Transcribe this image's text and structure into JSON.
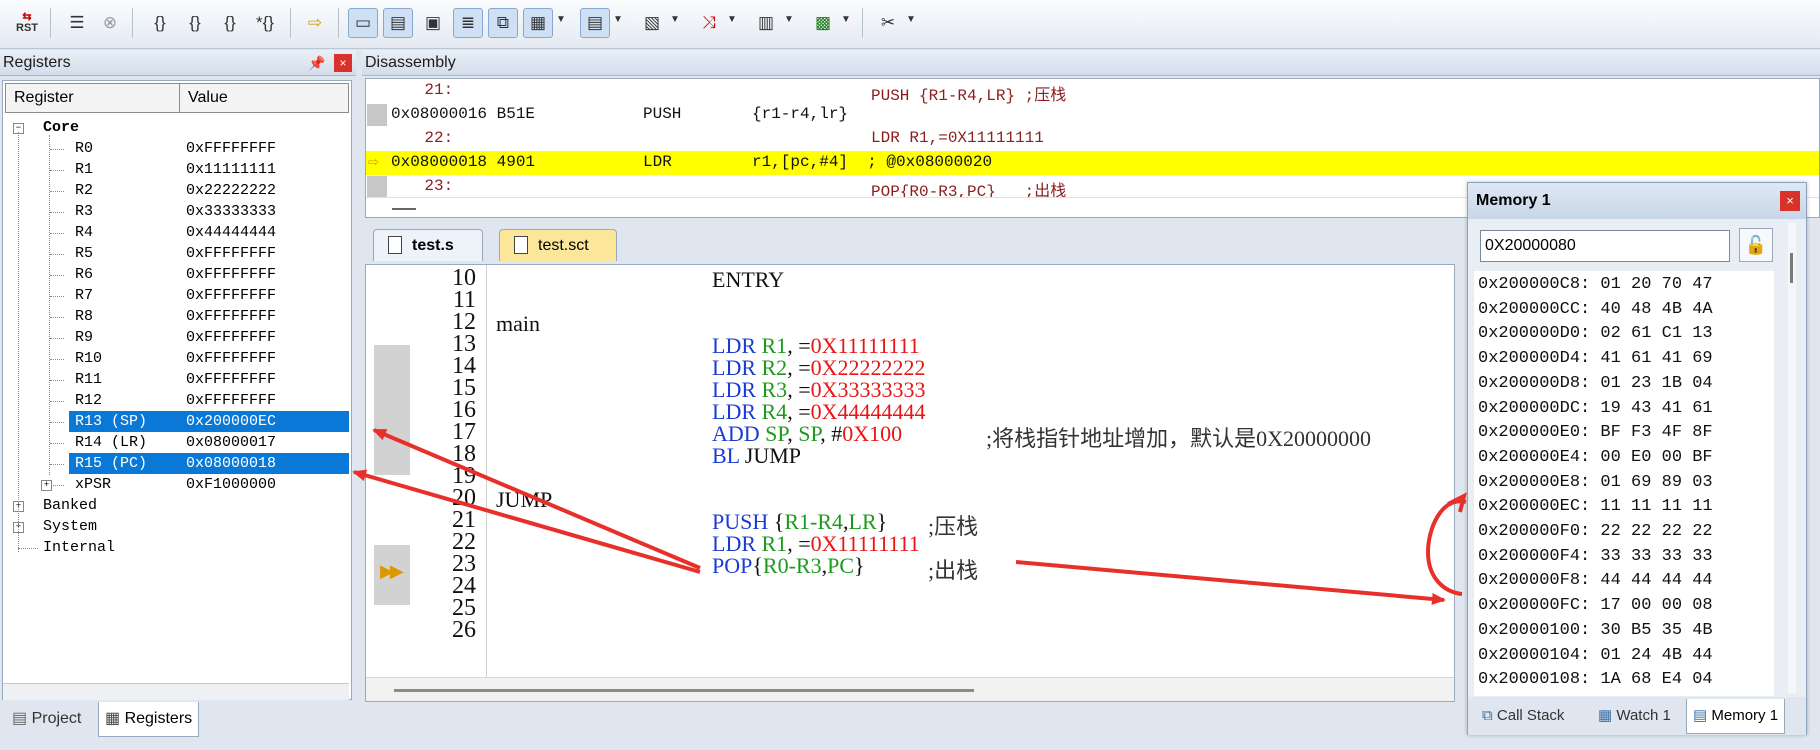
{
  "toolbar": {
    "rst_label": "RST"
  },
  "registers": {
    "title": "Registers",
    "col_register": "Register",
    "col_value": "Value",
    "core_label": "Core",
    "rows": [
      {
        "name": "R0",
        "value": "0xFFFFFFFF"
      },
      {
        "name": "R1",
        "value": "0x11111111"
      },
      {
        "name": "R2",
        "value": "0x22222222"
      },
      {
        "name": "R3",
        "value": "0x33333333"
      },
      {
        "name": "R4",
        "value": "0x44444444"
      },
      {
        "name": "R5",
        "value": "0xFFFFFFFF"
      },
      {
        "name": "R6",
        "value": "0xFFFFFFFF"
      },
      {
        "name": "R7",
        "value": "0xFFFFFFFF"
      },
      {
        "name": "R8",
        "value": "0xFFFFFFFF"
      },
      {
        "name": "R9",
        "value": "0xFFFFFFFF"
      },
      {
        "name": "R10",
        "value": "0xFFFFFFFF"
      },
      {
        "name": "R11",
        "value": "0xFFFFFFFF"
      },
      {
        "name": "R12",
        "value": "0xFFFFFFFF"
      },
      {
        "name": "R13 (SP)",
        "value": "0x200000EC"
      },
      {
        "name": "R14 (LR)",
        "value": "0x08000017"
      },
      {
        "name": "R15 (PC)",
        "value": "0x08000018"
      },
      {
        "name": "xPSR",
        "value": "0xF1000000"
      }
    ],
    "groups": [
      "Banked",
      "System",
      "Internal"
    ],
    "tab_project": "Project",
    "tab_registers": "Registers"
  },
  "disassembly": {
    "title": "Disassembly",
    "lines": [
      {
        "addr": "    21:",
        "op": "",
        "args": "",
        "src": "PUSH {R1-R4,LR} ;压栈"
      },
      {
        "addr": "0x08000016 B51E",
        "op": "PUSH",
        "args": "{r1-r4,lr}",
        "src": ""
      },
      {
        "addr": "    22:",
        "op": "",
        "args": "",
        "src": "LDR R1,=0X11111111"
      },
      {
        "addr": "0x08000018 4901",
        "op": "LDR",
        "args": "r1,[pc,#4]  ; @0x08000020",
        "src": ""
      },
      {
        "addr": "    23:",
        "op": "",
        "args": "",
        "src": "POP{R0-R3,PC}   ;出栈"
      }
    ]
  },
  "editor": {
    "tabs": [
      "test.s",
      "test.sct"
    ],
    "line_numbers": [
      "10",
      "11",
      "12",
      "13",
      "14",
      "15",
      "16",
      "17",
      "18",
      "19",
      "20",
      "21",
      "22",
      "23",
      "24",
      "25",
      "26"
    ],
    "code": {
      "l10": "ENTRY",
      "l12": "main",
      "ldr": "LDR",
      "r1": "R1",
      "r2": "R2",
      "r3": "R3",
      "r4": "R4",
      "eq": ", =",
      "v1": "0X11111111",
      "v2": "0X22222222",
      "v3": "0X33333333",
      "v4": "0X44444444",
      "add": "ADD",
      "sp": "SP",
      "comma": ",",
      "hash": ", #",
      "v100": "0X100",
      "c17": ";将栈指针地址增加，默认是0X20000000",
      "bl": "BL",
      "jumpref": "JUMP",
      "l20": "JUMP",
      "push": "PUSH",
      "push_open": " {",
      "push_regs": "R1-R4",
      "lr": "LR",
      "push_close": "}",
      "c21": ";压栈",
      "pop": "POP",
      "pop_open": "{",
      "pop_regs": "R0-R3",
      "pc": "PC",
      "pop_close": "}",
      "c23": ";出栈"
    }
  },
  "memory": {
    "title": "Memory 1",
    "address": "0X20000080",
    "rows": [
      "0x200000C8: 01 20 70 47",
      "0x200000CC: 40 48 4B 4A",
      "0x200000D0: 02 61 C1 13",
      "0x200000D4: 41 61 41 69",
      "0x200000D8: 01 23 1B 04",
      "0x200000DC: 19 43 41 61",
      "0x200000E0: BF F3 4F 8F",
      "0x200000E4: 00 E0 00 BF",
      "0x200000E8: 01 69 89 03",
      "0x200000EC: 11 11 11 11",
      "0x200000F0: 22 22 22 22",
      "0x200000F4: 33 33 33 33",
      "0x200000F8: 44 44 44 44",
      "0x200000FC: 17 00 00 08",
      "0x20000100: 30 B5 35 4B",
      "0x20000104: 01 24 4B 44",
      "0x20000108: 1A 68 E4 04"
    ],
    "tab_callstack": "Call Stack",
    "tab_watch": "Watch 1",
    "tab_memory": "Memory 1"
  },
  "colors": {
    "highlight": "#ffff00",
    "selection": "#0a78d7",
    "arrow": "#e8302a"
  }
}
